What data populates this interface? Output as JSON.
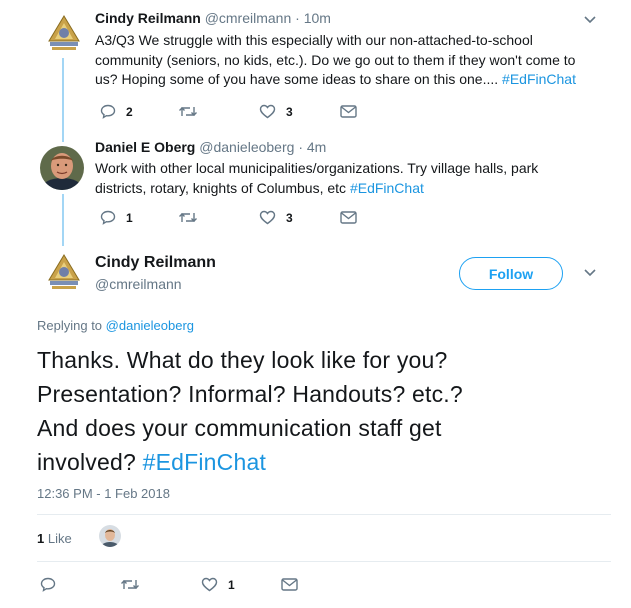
{
  "tweet1": {
    "name": "Cindy Reilmann",
    "handle": "@cmreilmann",
    "time": "· 10m",
    "line1": "A3/Q3   We struggle with this especially with our non-attached-to-school",
    "line2": "community (seniors, no kids, etc.).  Do we go out to them if they won't come to",
    "line3": "us?  Hoping some of you have some ideas to share on this one.... ",
    "hashtag": "#EdFinChat",
    "replies": "2",
    "likes": "3"
  },
  "tweet2": {
    "name": "Daniel E Oberg",
    "handle": "@danieleoberg",
    "time": "· 4m",
    "line1": "Work with other local municipalities/organizations. Try village halls, park",
    "line2": "districts, rotary, knights of Columbus, etc ",
    "hashtag": "#EdFinChat",
    "replies": "1",
    "likes": "3"
  },
  "main": {
    "name": "Cindy Reilmann",
    "handle": "@cmreilmann",
    "follow_label": "Follow",
    "replying_prefix": "Replying to ",
    "replying_handle": "@danieleoberg",
    "line1": "Thanks. What do they look like for you?",
    "line2": "Presentation? Informal? Handouts? etc.?",
    "line3": "And does your communication staff get",
    "line4": "involved?  ",
    "hashtag": "#EdFinChat",
    "timestamp": "12:36 PM - 1 Feb 2018",
    "like_count": "1",
    "like_label": "Like",
    "action_likes": "1"
  },
  "colors": {
    "accent": "#1da1f2",
    "hashtag": "#1b95e0",
    "muted": "#657786",
    "thread_line": "#a3d6f5"
  }
}
